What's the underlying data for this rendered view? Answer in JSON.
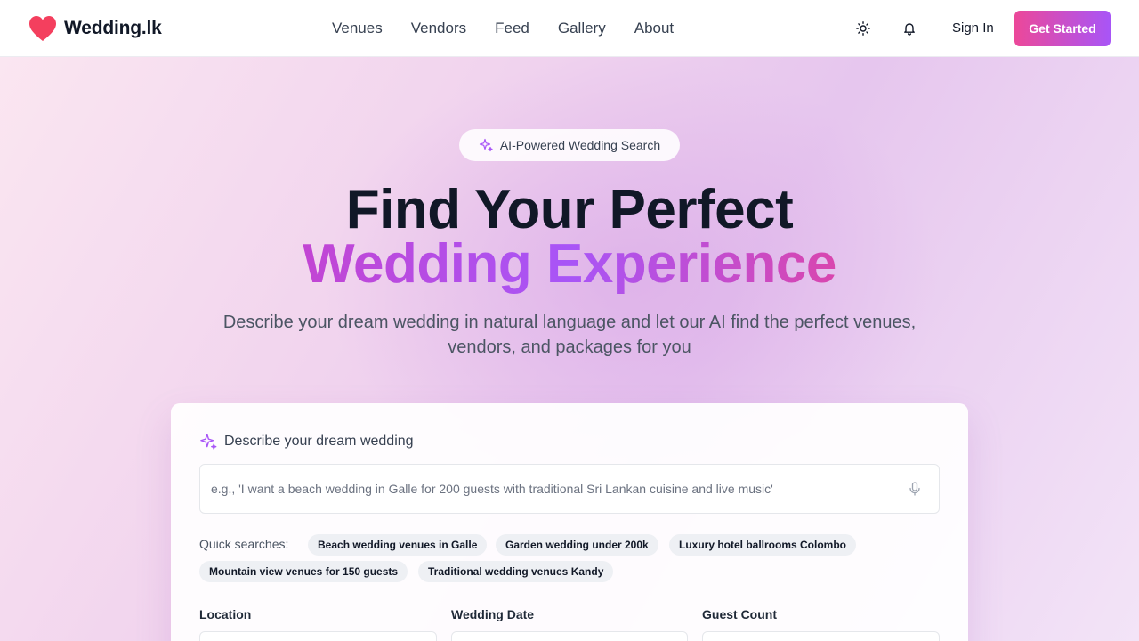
{
  "brand": {
    "name": "Wedding.lk",
    "logo_icon": "heart-icon",
    "accent": "#f43f5e"
  },
  "nav": {
    "items": [
      "Venues",
      "Vendors",
      "Feed",
      "Gallery",
      "About"
    ]
  },
  "header": {
    "theme_icon": "sun-icon",
    "notification_icon": "bell-icon",
    "sign_in": "Sign In",
    "get_started": "Get Started",
    "cta_gradient": [
      "#ec4899",
      "#a855f7"
    ]
  },
  "hero": {
    "badge": "AI-Powered Wedding Search",
    "title_line1": "Find Your Perfect",
    "title_line2": "Wedding Experience",
    "subtitle": "Describe your dream wedding in natural language and let our AI find the perfect venues, vendors, and packages for you"
  },
  "search": {
    "heading": "Describe your dream wedding",
    "placeholder": "e.g., 'I want a beach wedding in Galle for 200 guests with traditional Sri Lankan cuisine and live music'",
    "quick_label": "Quick searches:",
    "quick_searches": [
      "Beach wedding venues in Galle",
      "Garden wedding under 200k",
      "Luxury hotel ballrooms Colombo",
      "Mountain view venues for 150 guests",
      "Traditional wedding venues Kandy"
    ],
    "fields": [
      "Location",
      "Wedding Date",
      "Guest Count"
    ]
  }
}
